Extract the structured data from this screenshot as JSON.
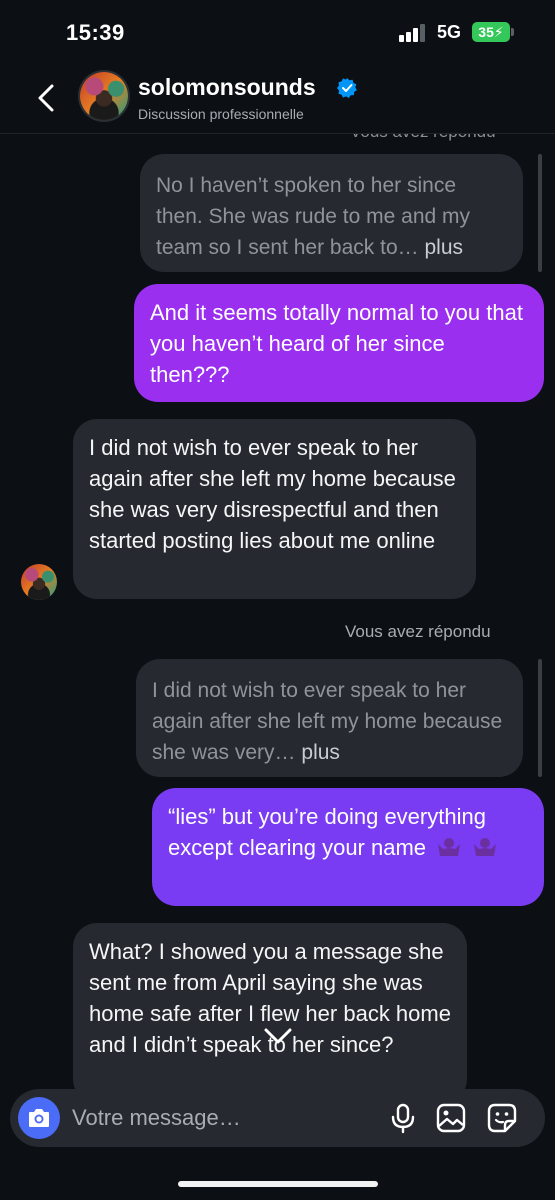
{
  "status_bar": {
    "time": "15:39",
    "network": "5G",
    "battery": "35"
  },
  "header": {
    "username": "solomonsounds",
    "subtitle": "Discussion professionnelle"
  },
  "chat": {
    "cut_label": "Vous avez répondu",
    "messages": [
      {
        "type": "quote",
        "text": "No I haven’t spoken to her since then. She was rude to me and my team so I sent her back to…",
        "more": "plus"
      },
      {
        "type": "outgoing",
        "text": "And it seems totally normal to you that you haven’t heard of her since then???"
      },
      {
        "type": "incoming",
        "text": "I did not wish to ever speak to her again after she left my home because she was very disrespectful and then started posting lies about me online"
      },
      {
        "type": "replied_label",
        "text": "Vous avez répondu"
      },
      {
        "type": "quote",
        "text": "I did not wish to ever speak to her again after she left my home because she was very…",
        "more": "plus"
      },
      {
        "type": "outgoing",
        "text": "“lies” but you’re doing everything except clearing your name"
      },
      {
        "type": "incoming",
        "text": "What? I showed you a message she sent me from April saying she was home safe after I flew her back home and I didn’t speak to her since?"
      }
    ]
  },
  "composer": {
    "placeholder": "Votre message…"
  },
  "icons": {
    "back": "chevron-left-icon",
    "verified": "verified-badge-icon",
    "camera": "camera-icon",
    "mic": "microphone-icon",
    "gallery": "gallery-icon",
    "sticker": "sticker-icon",
    "scroll": "chevron-down-icon",
    "emoji": "purple-person-shrugging-emoji"
  },
  "colors": {
    "accent_purple": "#9a2ff0",
    "accent_violet": "#7a3cf2",
    "camera_blue": "#4a6cf7",
    "verified_blue": "#0095f6",
    "battery_green": "#34c759"
  }
}
